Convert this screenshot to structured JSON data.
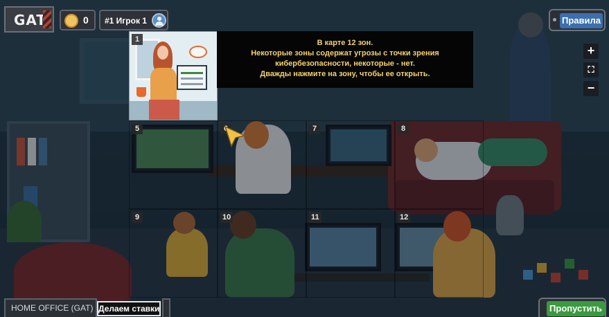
{
  "header": {
    "logo_text": "GAT",
    "coins": "0",
    "player_label": "#1 Игрок 1",
    "rules_label": "Правила"
  },
  "tooltip": {
    "lines": [
      "В карте 12 зон.",
      "Некоторые зоны содержат угрозы с точки зрения",
      "кибербезопасности, некоторые - нет.",
      "Дважды нажмите на зону, чтобы ее открыть."
    ]
  },
  "zones": {
    "z1": "1",
    "z5": "5",
    "z6": "6",
    "z7": "7",
    "z8": "8",
    "z9": "9",
    "z10": "10",
    "z11": "11",
    "z12": "12"
  },
  "zoom": {
    "plus": "+",
    "fit": "⛶",
    "minus": "−"
  },
  "footer": {
    "location": "HOME OFFICE (GAT)",
    "task": "Делаем ставки",
    "skip_label": "Пропустить"
  },
  "colors": {
    "tooltip_text": "#f5d36a",
    "rules_button": "#3b6fb0",
    "skip_button": "#3b9a3f",
    "coin": "#f1c35e"
  }
}
